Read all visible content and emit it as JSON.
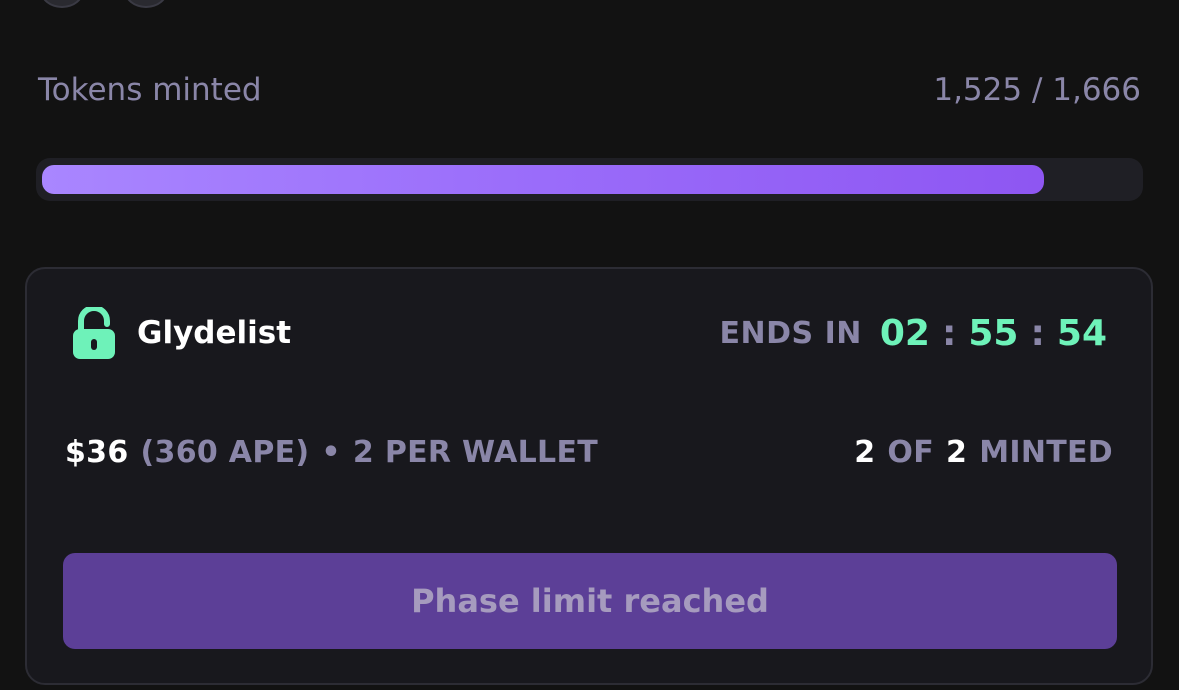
{
  "mint_progress": {
    "label": "Tokens minted",
    "count_text": "1,525 / 1,666",
    "minted": 1525,
    "total": 1666,
    "fraction": 0.915
  },
  "phase": {
    "name": "Glydelist",
    "ends_label": "ENDS IN",
    "countdown": {
      "hours": "02",
      "minutes": "55",
      "seconds": "54",
      "separator": ":"
    },
    "price_usd": "$36",
    "price_ape": "(360 APE)",
    "bullet": "•",
    "per_wallet": "2 PER WALLET",
    "minted_count": "2",
    "of_label": "OF",
    "minted_limit": "2",
    "minted_label": "MINTED",
    "button_label": "Phase limit reached"
  },
  "colors": {
    "accent_green": "#6ef2b9",
    "accent_purple": "#9a6cfa",
    "button_bg": "#5c3f97",
    "muted_text": "#8a86a8"
  },
  "icons": {
    "phase_icon": "unlocked-padlock-icon"
  }
}
